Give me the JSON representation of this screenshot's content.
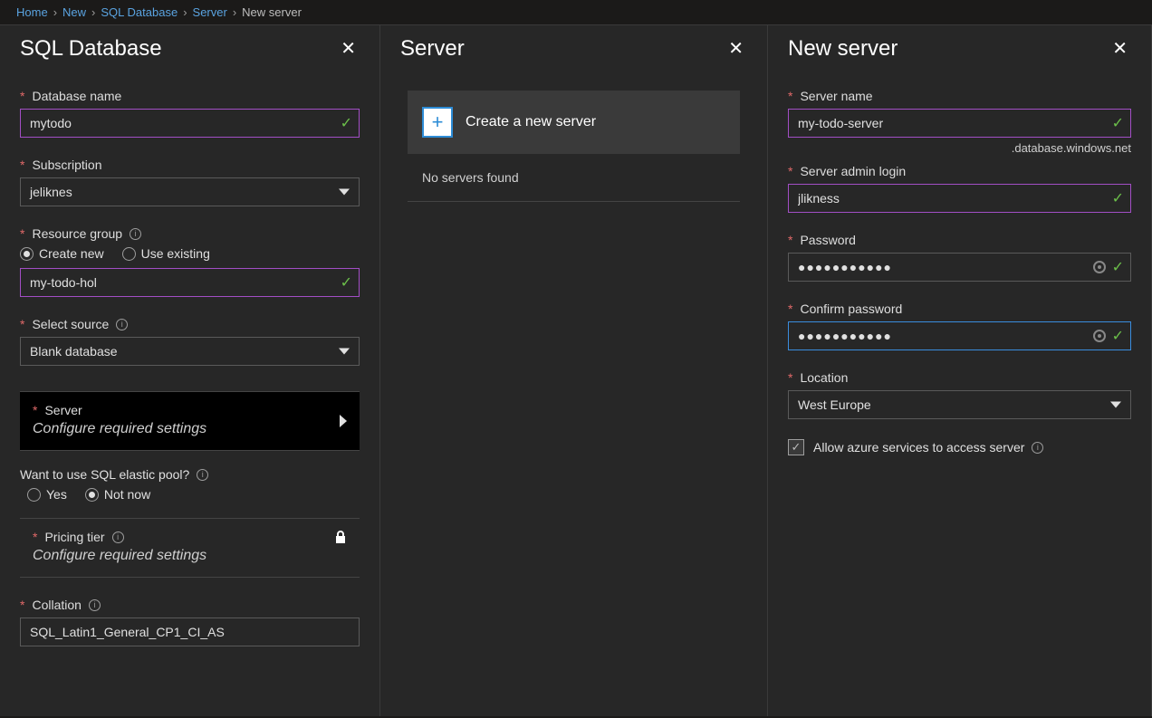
{
  "breadcrumb": [
    "Home",
    "New",
    "SQL Database",
    "Server",
    "New server"
  ],
  "panels": {
    "sql": {
      "title": "SQL Database",
      "fields": {
        "database_name_label": "Database name",
        "database_name_value": "mytodo",
        "subscription_label": "Subscription",
        "subscription_value": "jeliknes",
        "resource_group_label": "Resource group",
        "rg_create_new": "Create new",
        "rg_use_existing": "Use existing",
        "resource_group_value": "my-todo-hol",
        "select_source_label": "Select source",
        "select_source_value": "Blank database",
        "server_label": "Server",
        "server_sub": "Configure required settings",
        "elastic_label": "Want to use SQL elastic pool?",
        "elastic_yes": "Yes",
        "elastic_notnow": "Not now",
        "pricing_label": "Pricing tier",
        "pricing_sub": "Configure required settings",
        "collation_label": "Collation",
        "collation_value": "SQL_Latin1_General_CP1_CI_AS"
      }
    },
    "server": {
      "title": "Server",
      "create_label": "Create a new server",
      "no_servers": "No servers found"
    },
    "newserver": {
      "title": "New server",
      "server_name_label": "Server name",
      "server_name_value": "my-todo-server",
      "suffix": ".database.windows.net",
      "admin_login_label": "Server admin login",
      "admin_login_value": "jlikness",
      "password_label": "Password",
      "password_value": "●●●●●●●●●●●",
      "confirm_label": "Confirm password",
      "confirm_value": "●●●●●●●●●●●",
      "location_label": "Location",
      "location_value": "West Europe",
      "allow_azure": "Allow azure services to access server"
    }
  }
}
